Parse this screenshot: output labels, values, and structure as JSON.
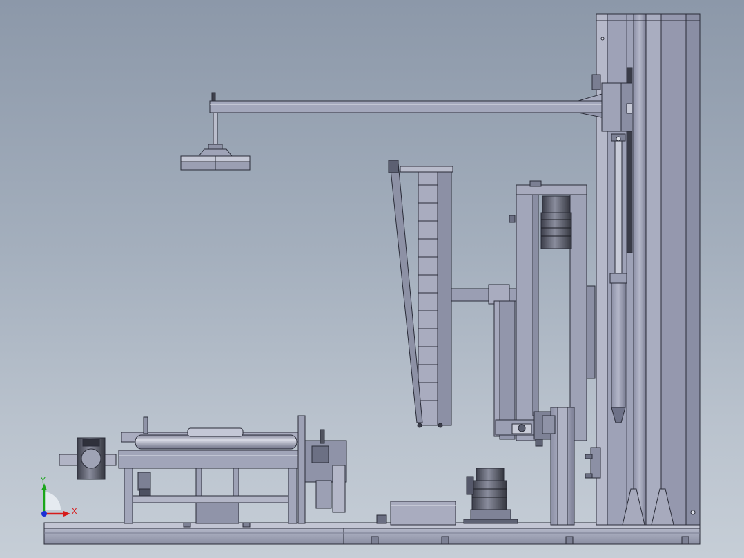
{
  "triad": {
    "x_label": "X",
    "y_label": "Y",
    "colors": {
      "x": "#d61b1b",
      "y": "#1aa61a",
      "z": "#1b2fd6"
    }
  },
  "colors": {
    "background_top": "#8c98a9",
    "background_bottom": "#c6ced7",
    "steel_face": "#9ea2b7",
    "steel_dark": "#6e7288",
    "steel_light": "#c4c7d6",
    "outline": "#2a2c38"
  },
  "icons": [
    "coordinate-triad-icon"
  ]
}
